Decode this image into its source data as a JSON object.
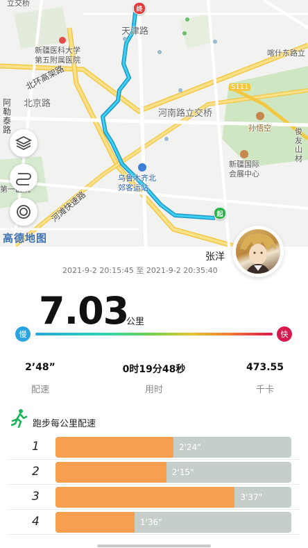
{
  "map": {
    "labels": {
      "lizhi_bridge": "立交桥",
      "tianjin_road": "天津路",
      "xinjiang_medical": "新疆医科大学\n第五附属医院",
      "kashi_east_road": "喀什东路立",
      "beijing_road": "北京路",
      "s111": "S111",
      "henan_interchange": "河南路立交桥",
      "sunwukong": "孙悟空",
      "junyou": "俊友山材",
      "xinjiang_expo": "新疆国际\n会展中心",
      "urumqi_bus": "乌鲁木齐北\n郊客运站",
      "first_hospital": "第一医院",
      "amap_logo": "高德地图",
      "north_ring": "北环高架路",
      "henan_expressway": "河滩快速路",
      "yan_road": "阿勒泰路"
    },
    "start_marker": "起",
    "end_marker": "终",
    "controls": [
      "layers-icon",
      "route-icon",
      "location-icon"
    ],
    "route_color": "#29b9e0"
  },
  "profile": {
    "name": "张洋",
    "time_range": "2021-9-2 20:15:45 至 2021-9-2 20:35:40"
  },
  "distance": {
    "value": "7.03",
    "unit": "公里"
  },
  "pace_scale": {
    "slow": "慢",
    "fast": "快"
  },
  "stats": [
    {
      "value": "2’48”",
      "label": "配速"
    },
    {
      "value": "0时19分48秒",
      "label": "用时"
    },
    {
      "value": "473.55",
      "label": "千卡"
    }
  ],
  "splits": {
    "title": "跑步每公里配速",
    "rows": [
      {
        "index": "1",
        "pace": "2'24\"",
        "fraction": 0.5
      },
      {
        "index": "2",
        "pace": "2'15\"",
        "fraction": 0.47
      },
      {
        "index": "3",
        "pace": "3'37\"",
        "fraction": 0.76
      },
      {
        "index": "4",
        "pace": "1'36\"",
        "fraction": 0.335
      }
    ],
    "fill_color": "#f6a04f",
    "track_color": "#c6cec9"
  }
}
